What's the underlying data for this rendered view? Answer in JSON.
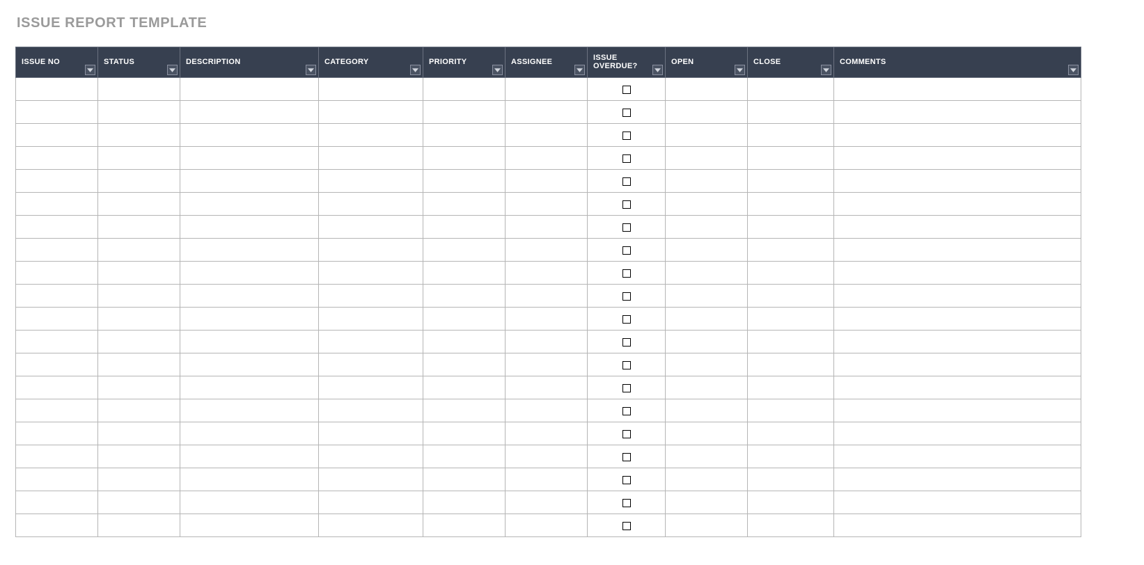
{
  "title": "ISSUE REPORT TEMPLATE",
  "columns": [
    {
      "key": "issue_no",
      "label": "ISSUE NO",
      "filter": true,
      "class": "c-issueno"
    },
    {
      "key": "status",
      "label": "STATUS",
      "filter": true,
      "class": "c-status"
    },
    {
      "key": "desc",
      "label": "DESCRIPTION",
      "filter": true,
      "class": "c-desc"
    },
    {
      "key": "category",
      "label": "CATEGORY",
      "filter": true,
      "class": "c-category"
    },
    {
      "key": "priority",
      "label": "PRIORITY",
      "filter": true,
      "class": "c-priority"
    },
    {
      "key": "assignee",
      "label": "ASSIGNEE",
      "filter": true,
      "class": "c-assignee"
    },
    {
      "key": "overdue",
      "label": "ISSUE OVERDUE?",
      "filter": true,
      "class": "c-overdue"
    },
    {
      "key": "open",
      "label": "OPEN",
      "filter": true,
      "class": "c-open"
    },
    {
      "key": "close",
      "label": "CLOSE",
      "filter": true,
      "class": "c-close"
    },
    {
      "key": "comments",
      "label": "COMMENTS",
      "filter": true,
      "class": "c-comments"
    }
  ],
  "rows": [
    {
      "issue_no": "",
      "status": "",
      "desc": "",
      "category": "",
      "priority": "",
      "assignee": "",
      "overdue": false,
      "open": "",
      "close": "",
      "comments": ""
    },
    {
      "issue_no": "",
      "status": "",
      "desc": "",
      "category": "",
      "priority": "",
      "assignee": "",
      "overdue": false,
      "open": "",
      "close": "",
      "comments": ""
    },
    {
      "issue_no": "",
      "status": "",
      "desc": "",
      "category": "",
      "priority": "",
      "assignee": "",
      "overdue": false,
      "open": "",
      "close": "",
      "comments": ""
    },
    {
      "issue_no": "",
      "status": "",
      "desc": "",
      "category": "",
      "priority": "",
      "assignee": "",
      "overdue": false,
      "open": "",
      "close": "",
      "comments": ""
    },
    {
      "issue_no": "",
      "status": "",
      "desc": "",
      "category": "",
      "priority": "",
      "assignee": "",
      "overdue": false,
      "open": "",
      "close": "",
      "comments": ""
    },
    {
      "issue_no": "",
      "status": "",
      "desc": "",
      "category": "",
      "priority": "",
      "assignee": "",
      "overdue": false,
      "open": "",
      "close": "",
      "comments": ""
    },
    {
      "issue_no": "",
      "status": "",
      "desc": "",
      "category": "",
      "priority": "",
      "assignee": "",
      "overdue": false,
      "open": "",
      "close": "",
      "comments": ""
    },
    {
      "issue_no": "",
      "status": "",
      "desc": "",
      "category": "",
      "priority": "",
      "assignee": "",
      "overdue": false,
      "open": "",
      "close": "",
      "comments": ""
    },
    {
      "issue_no": "",
      "status": "",
      "desc": "",
      "category": "",
      "priority": "",
      "assignee": "",
      "overdue": false,
      "open": "",
      "close": "",
      "comments": ""
    },
    {
      "issue_no": "",
      "status": "",
      "desc": "",
      "category": "",
      "priority": "",
      "assignee": "",
      "overdue": false,
      "open": "",
      "close": "",
      "comments": ""
    },
    {
      "issue_no": "",
      "status": "",
      "desc": "",
      "category": "",
      "priority": "",
      "assignee": "",
      "overdue": false,
      "open": "",
      "close": "",
      "comments": ""
    },
    {
      "issue_no": "",
      "status": "",
      "desc": "",
      "category": "",
      "priority": "",
      "assignee": "",
      "overdue": false,
      "open": "",
      "close": "",
      "comments": ""
    },
    {
      "issue_no": "",
      "status": "",
      "desc": "",
      "category": "",
      "priority": "",
      "assignee": "",
      "overdue": false,
      "open": "",
      "close": "",
      "comments": ""
    },
    {
      "issue_no": "",
      "status": "",
      "desc": "",
      "category": "",
      "priority": "",
      "assignee": "",
      "overdue": false,
      "open": "",
      "close": "",
      "comments": ""
    },
    {
      "issue_no": "",
      "status": "",
      "desc": "",
      "category": "",
      "priority": "",
      "assignee": "",
      "overdue": false,
      "open": "",
      "close": "",
      "comments": ""
    },
    {
      "issue_no": "",
      "status": "",
      "desc": "",
      "category": "",
      "priority": "",
      "assignee": "",
      "overdue": false,
      "open": "",
      "close": "",
      "comments": ""
    },
    {
      "issue_no": "",
      "status": "",
      "desc": "",
      "category": "",
      "priority": "",
      "assignee": "",
      "overdue": false,
      "open": "",
      "close": "",
      "comments": ""
    },
    {
      "issue_no": "",
      "status": "",
      "desc": "",
      "category": "",
      "priority": "",
      "assignee": "",
      "overdue": false,
      "open": "",
      "close": "",
      "comments": ""
    },
    {
      "issue_no": "",
      "status": "",
      "desc": "",
      "category": "",
      "priority": "",
      "assignee": "",
      "overdue": false,
      "open": "",
      "close": "",
      "comments": ""
    },
    {
      "issue_no": "",
      "status": "",
      "desc": "",
      "category": "",
      "priority": "",
      "assignee": "",
      "overdue": false,
      "open": "",
      "close": "",
      "comments": ""
    }
  ]
}
